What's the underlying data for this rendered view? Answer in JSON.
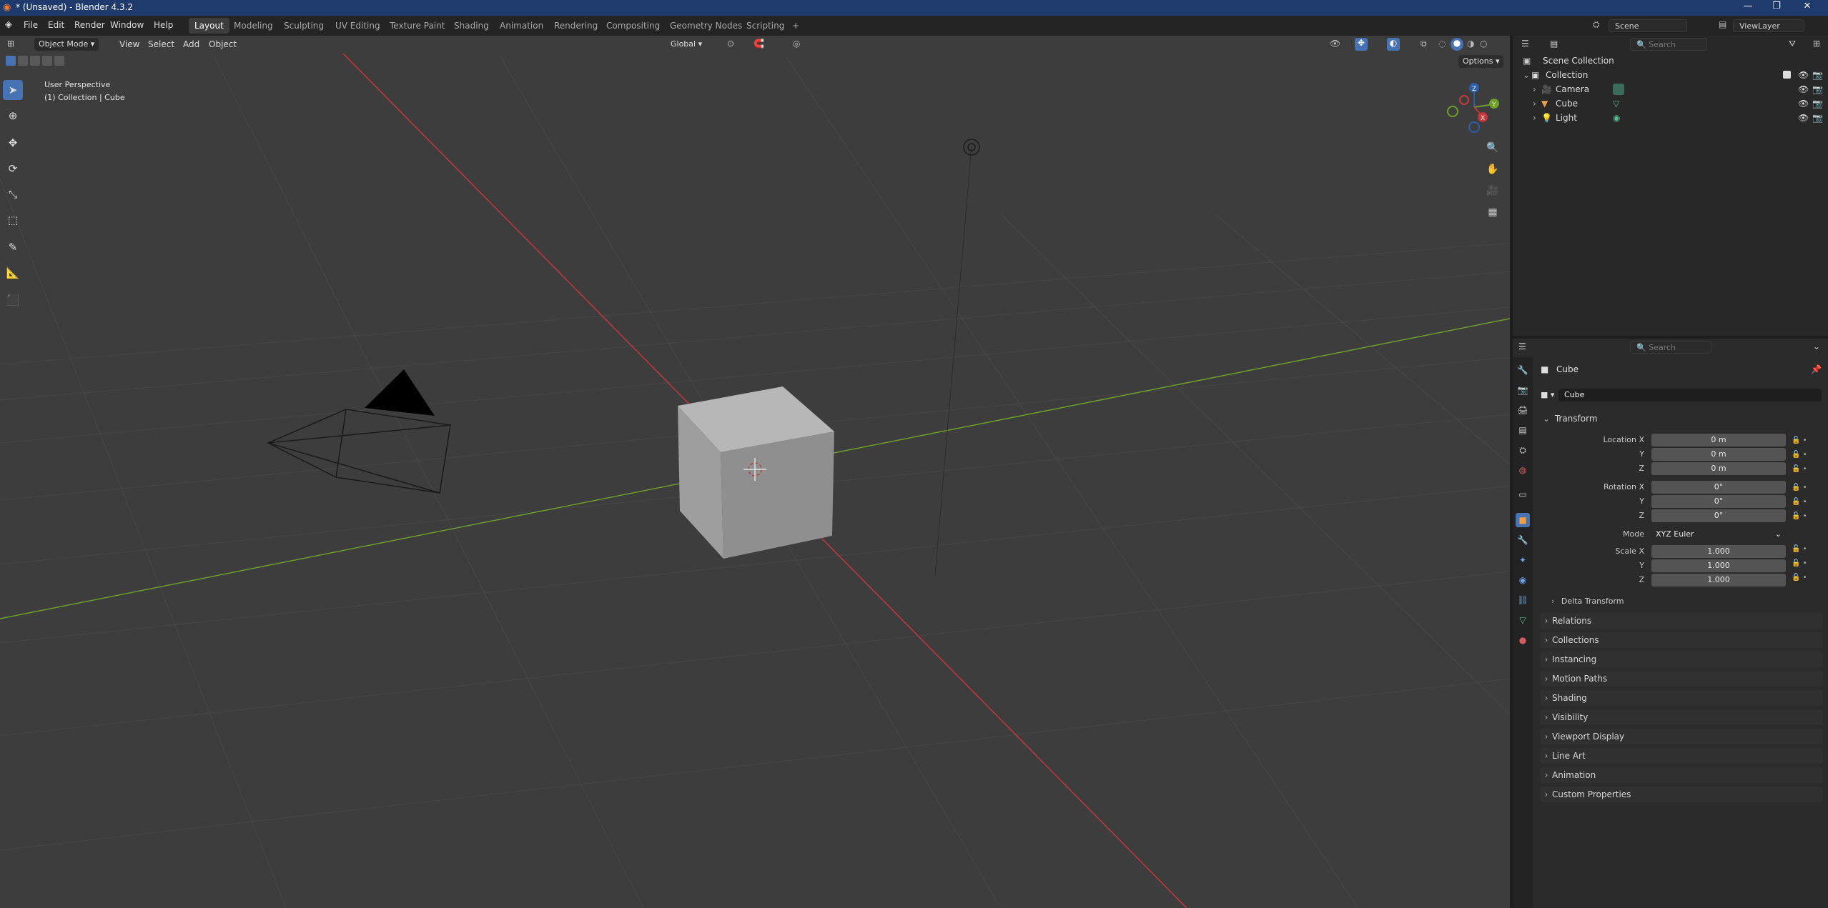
{
  "window": {
    "title": "* (Unsaved) - Blender 4.3.2",
    "minimize": "—",
    "maximize": "❐",
    "close": "✕"
  },
  "menu": [
    "File",
    "Edit",
    "Render",
    "Window",
    "Help"
  ],
  "workspaces": [
    "Layout",
    "Modeling",
    "Sculpting",
    "UV Editing",
    "Texture Paint",
    "Shading",
    "Animation",
    "Rendering",
    "Compositing",
    "Geometry Nodes",
    "Scripting",
    "+"
  ],
  "active_workspace": "Layout",
  "scene_name": "Scene",
  "view_layer": "ViewLayer",
  "viewport": {
    "mode": "Object Mode",
    "menus": [
      "View",
      "Select",
      "Add",
      "Object"
    ],
    "orientation": "Global",
    "options_label": "Options",
    "overlay_line1": "User Perspective",
    "overlay_line2": "(1) Collection | Cube",
    "gizmo_axes": {
      "z": "Z",
      "y": "Y",
      "x": "X"
    }
  },
  "outliner": {
    "search_placeholder": "Search",
    "root": "Scene Collection",
    "collection": "Collection",
    "items": [
      "Camera",
      "Cube",
      "Light"
    ]
  },
  "properties": {
    "search_placeholder": "Search",
    "object_name": "Cube",
    "datablock_name": "Cube",
    "transform_title": "Transform",
    "location_label": "Location X",
    "rotation_label": "Rotation X",
    "scale_label": "Scale X",
    "y_label": "Y",
    "z_label": "Z",
    "location": [
      "0 m",
      "0 m",
      "0 m"
    ],
    "rotation": [
      "0°",
      "0°",
      "0°"
    ],
    "mode_label": "Mode",
    "mode_value": "XYZ Euler",
    "scale": [
      "1.000",
      "1.000",
      "1.000"
    ],
    "delta_transform": "Delta Transform",
    "panels": [
      "Relations",
      "Collections",
      "Instancing",
      "Motion Paths",
      "Shading",
      "Visibility",
      "Viewport Display",
      "Line Art",
      "Animation",
      "Custom Properties"
    ]
  },
  "colors": {
    "accent": "#4772b3",
    "x_axis": "#c3383a",
    "y_axis": "#6d9e2a",
    "titlebar": "#1f3b6e"
  }
}
